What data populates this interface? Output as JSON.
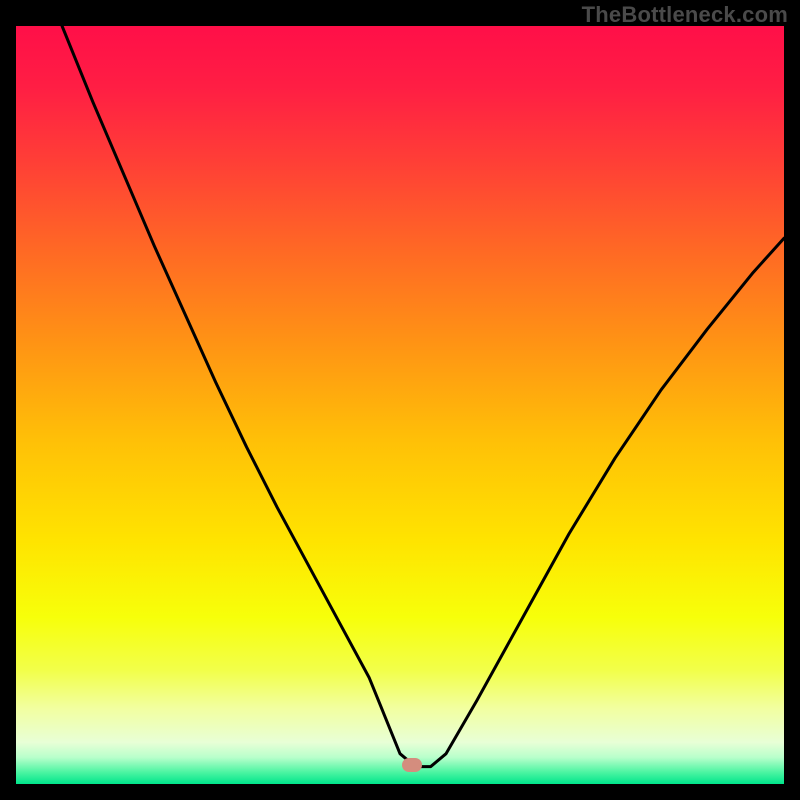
{
  "attribution": "TheBottleneck.com",
  "gradient_stops": [
    {
      "offset": 0.0,
      "color": "#ff0f48"
    },
    {
      "offset": 0.08,
      "color": "#ff1e44"
    },
    {
      "offset": 0.18,
      "color": "#ff3f36"
    },
    {
      "offset": 0.3,
      "color": "#ff6a24"
    },
    {
      "offset": 0.42,
      "color": "#ff9414"
    },
    {
      "offset": 0.55,
      "color": "#ffc107"
    },
    {
      "offset": 0.68,
      "color": "#ffe400"
    },
    {
      "offset": 0.78,
      "color": "#f7ff0a"
    },
    {
      "offset": 0.85,
      "color": "#f2ff4a"
    },
    {
      "offset": 0.9,
      "color": "#f2ffa0"
    },
    {
      "offset": 0.945,
      "color": "#e8ffd6"
    },
    {
      "offset": 0.965,
      "color": "#b8ffcb"
    },
    {
      "offset": 0.985,
      "color": "#49f4a1"
    },
    {
      "offset": 1.0,
      "color": "#00e58b"
    }
  ],
  "marker": {
    "x_frac": 0.515,
    "y_frac": 0.975
  },
  "chart_data": {
    "type": "line",
    "title": "",
    "xlabel": "",
    "ylabel": "",
    "xlim": [
      0,
      100
    ],
    "ylim": [
      0,
      100
    ],
    "series": [
      {
        "name": "bottleneck-curve",
        "x": [
          6,
          10,
          14,
          18,
          22,
          26,
          30,
          34,
          38,
          42,
          46,
          48,
          50,
          52,
          54,
          56,
          60,
          66,
          72,
          78,
          84,
          90,
          96,
          100
        ],
        "y": [
          100,
          90,
          80.5,
          71,
          62,
          53,
          44.5,
          36.5,
          29,
          21.5,
          14,
          9,
          4,
          2.3,
          2.3,
          4,
          11,
          22,
          33,
          43,
          52,
          60,
          67.5,
          72
        ]
      }
    ],
    "annotations": [
      {
        "name": "optimal-marker",
        "x": 51.5,
        "y": 2.3
      }
    ]
  }
}
